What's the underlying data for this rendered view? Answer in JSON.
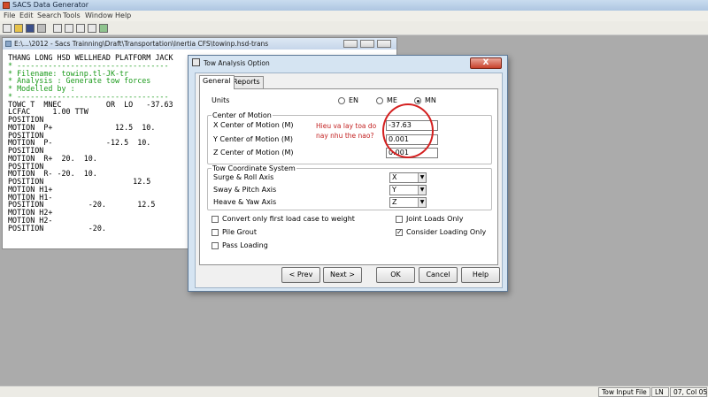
{
  "app": {
    "title": "SACS Data Generator",
    "menu": [
      "File",
      "Edit",
      "Search",
      "Tools",
      "Window",
      "Help"
    ],
    "toolbar_icons": [
      "new-file-icon",
      "open-icon",
      "save-icon",
      "print-icon",
      "cut-icon",
      "copy-icon",
      "paste-icon",
      "find-icon",
      "edit-icon"
    ]
  },
  "editor": {
    "title": "E:\\...\\2012 - Sacs Trainning\\Draft\\Transportation\\Inertia CFS\\towinp.hsd-trans",
    "lines": [
      {
        "t": "THANG LONG HSD WELLHEAD PLATFORM JACK",
        "c": "hd"
      },
      {
        "t": "* ----------------------------------",
        "c": "cm"
      },
      {
        "t": "* Filename: towinp.tl-JK-tr",
        "c": "cm"
      },
      {
        "t": "* Analysis : Generate tow forces",
        "c": "cm"
      },
      {
        "t": "* Modelled by :",
        "c": "cm"
      },
      {
        "t": "* ----------------------------------",
        "c": "cm"
      },
      {
        "t": "TOWC T  MNEC          OR  LO   -37.63",
        "c": "hd"
      },
      {
        "t": "LCFAC     1.00 TTW",
        "c": "hd"
      },
      {
        "t": "POSITION",
        "c": "hd"
      },
      {
        "t": "MOTION  P+              12.5  10.",
        "c": "hd"
      },
      {
        "t": "POSITION",
        "c": "hd"
      },
      {
        "t": "MOTION  P-            -12.5  10.",
        "c": "hd"
      },
      {
        "t": "POSITION",
        "c": "hd"
      },
      {
        "t": "MOTION  R+  20.  10.",
        "c": "hd"
      },
      {
        "t": "POSITION",
        "c": "hd"
      },
      {
        "t": "MOTION  R- -20.  10.",
        "c": "hd"
      },
      {
        "t": "POSITION                    12.5",
        "c": "hd"
      },
      {
        "t": "MOTION H1+",
        "c": "hd"
      },
      {
        "t": "MOTION H1-",
        "c": "hd"
      },
      {
        "t": "POSITION          -20.       12.5",
        "c": "hd"
      },
      {
        "t": "MOTION H2+",
        "c": "hd"
      },
      {
        "t": "MOTION H2-",
        "c": "hd"
      },
      {
        "t": "POSITION          -20.",
        "c": "hd"
      }
    ]
  },
  "dialog": {
    "title": "Tow Analysis Option",
    "close_label": "X",
    "tabs": [
      "General",
      "Reports"
    ],
    "units_label": "Units",
    "units": [
      {
        "label": "EN",
        "selected": false
      },
      {
        "label": "ME",
        "selected": false
      },
      {
        "label": "MN",
        "selected": true
      }
    ],
    "center_of_motion": {
      "title": "Center of Motion",
      "fields": [
        {
          "label": "X Center of Motion  (M)",
          "value": "-37.63"
        },
        {
          "label": "Y Center of Motion  (M)",
          "value": "0.001"
        },
        {
          "label": "Z Center of Motion  (M)",
          "value": "0.001"
        }
      ]
    },
    "tow_system": {
      "title": "Tow Coordinate System",
      "fields": [
        {
          "label": "Surge & Roll Axis",
          "value": "X"
        },
        {
          "label": "Sway & Pitch Axis",
          "value": "Y"
        },
        {
          "label": "Heave & Yaw Axis",
          "value": "Z"
        }
      ]
    },
    "checkboxes_left": [
      {
        "label": "Convert only first load case to weight",
        "checked": false
      },
      {
        "label": "Pile Grout",
        "checked": false
      },
      {
        "label": "Pass Loading",
        "checked": false
      }
    ],
    "checkboxes_right": [
      {
        "label": "Joint Loads Only",
        "checked": false
      },
      {
        "label": "Consider Loading Only",
        "checked": true
      }
    ],
    "buttons": {
      "prev": "< Prev",
      "next": "Next >",
      "ok": "OK",
      "cancel": "Cancel",
      "help": "Help"
    }
  },
  "annotation": {
    "line1": "Hieu va lay toa do",
    "line2": "nay nhu the nao?",
    "color": "#c21f1f"
  },
  "status": {
    "file_label": "Tow Input File",
    "mode": "LN",
    "position": "07, Col 05"
  }
}
